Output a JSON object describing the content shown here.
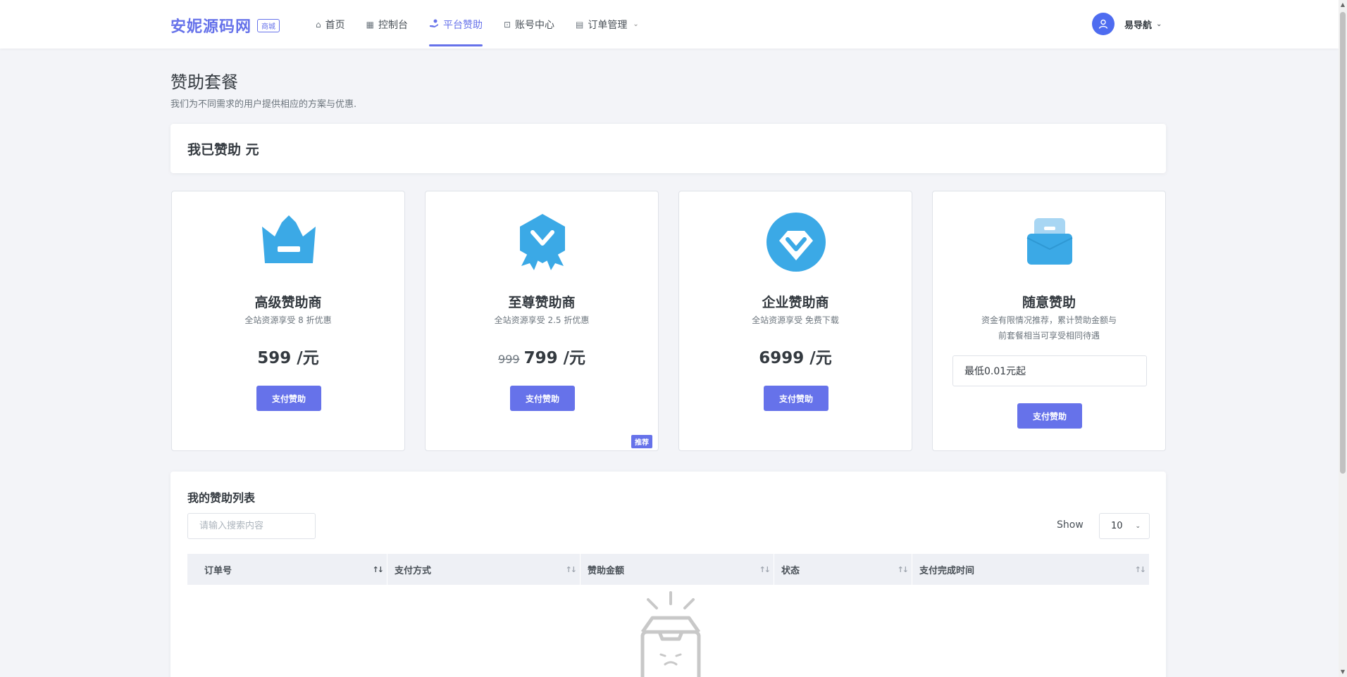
{
  "header": {
    "brand": "安妮源码网",
    "brand_tag": "商城",
    "nav": [
      {
        "label": "首页",
        "icon": "home-icon"
      },
      {
        "label": "控制台",
        "icon": "dashboard-icon"
      },
      {
        "label": "平台赞助",
        "icon": "sponsor-icon",
        "active": true
      },
      {
        "label": "账号中心",
        "icon": "user-card-icon"
      },
      {
        "label": "订单管理",
        "icon": "order-icon",
        "dropdown": true
      }
    ],
    "user": {
      "name": "易导航",
      "avatar_icon": "user-icon"
    }
  },
  "page": {
    "title": "赞助套餐",
    "subtitle": "我们为不同需求的用户提供相应的方案与优惠."
  },
  "sponsored": {
    "text": "我已赞助 元"
  },
  "plans": [
    {
      "name": "高级赞助商",
      "desc": "全站资源享受 8 折优惠",
      "price": "599 /元",
      "button": "支付赞助",
      "icon": "crown-icon"
    },
    {
      "name": "至尊赞助商",
      "desc": "全站资源享受 2.5 折优惠",
      "old_price": "999",
      "price": "799 /元",
      "button": "支付赞助",
      "badge": "推荐",
      "icon": "medal-icon"
    },
    {
      "name": "企业赞助商",
      "desc": "全站资源享受 免费下载",
      "price": "6999 /元",
      "button": "支付赞助",
      "icon": "diamond-icon"
    },
    {
      "name": "随意赞助",
      "desc_line1": "资金有限情况推荐，累计赞助金额与",
      "desc_line2": "前套餐相当可享受相同待遇",
      "input_value": "最低0.01元起",
      "button": "支付赞助",
      "icon": "wallet-icon"
    }
  ],
  "list": {
    "title": "我的赞助列表",
    "search_placeholder": "请输入搜索内容",
    "show_label": "Show",
    "show_value": "10",
    "columns": [
      "订单号",
      "支付方式",
      "赞助金额",
      "状态",
      "支付完成时间"
    ]
  },
  "colors": {
    "accent": "#6672ea",
    "icon_blue": "#3ba9e6",
    "icon_light": "#a8d6f3"
  }
}
